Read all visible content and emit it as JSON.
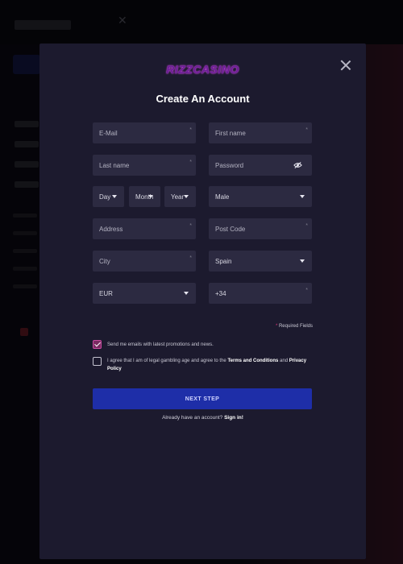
{
  "modal": {
    "logo_text": "RIZZCASINO",
    "title": "Create An Account"
  },
  "form": {
    "email": {
      "placeholder": "E-Mail",
      "required_mark": "*"
    },
    "first_name": {
      "placeholder": "First name",
      "required_mark": "*"
    },
    "last_name": {
      "placeholder": "Last name",
      "required_mark": "*"
    },
    "password": {
      "placeholder": "Password",
      "icon": "eye-slash-icon"
    },
    "dob_day": {
      "value": "Day"
    },
    "dob_month": {
      "value": "Month"
    },
    "dob_year": {
      "value": "Year"
    },
    "gender": {
      "value": "Male"
    },
    "address": {
      "placeholder": "Address",
      "required_mark": "*"
    },
    "post_code": {
      "placeholder": "Post Code",
      "required_mark": "*"
    },
    "city": {
      "placeholder": "City",
      "required_mark": "*"
    },
    "country": {
      "value": "Spain"
    },
    "currency": {
      "value": "EUR"
    },
    "phone_prefix": {
      "value": "+34",
      "required_mark": "*"
    }
  },
  "required_note": {
    "star": "*",
    "text": "Required Fields"
  },
  "consents": {
    "promotions_label": "Send me emails with latest promotions and news.",
    "promotions_checked": true,
    "terms_prefix": "I agree that I am of legal gambling age and agree to the",
    "terms_link": "Terms and Conditions",
    "terms_and": "and",
    "privacy_link": "Privacy Policy",
    "terms_checked": false
  },
  "actions": {
    "next_step": "NEXT STEP",
    "have_account": "Already have an account?",
    "sign_in": "Sign in!"
  },
  "colors": {
    "modal_bg": "#1c1a2e",
    "input_bg": "#2c2a41",
    "primary_button": "#1e2ea8",
    "checkbox_checked": "#7a2a61",
    "required_star": "#e0367a",
    "logo_pink": "#d84ae0"
  }
}
